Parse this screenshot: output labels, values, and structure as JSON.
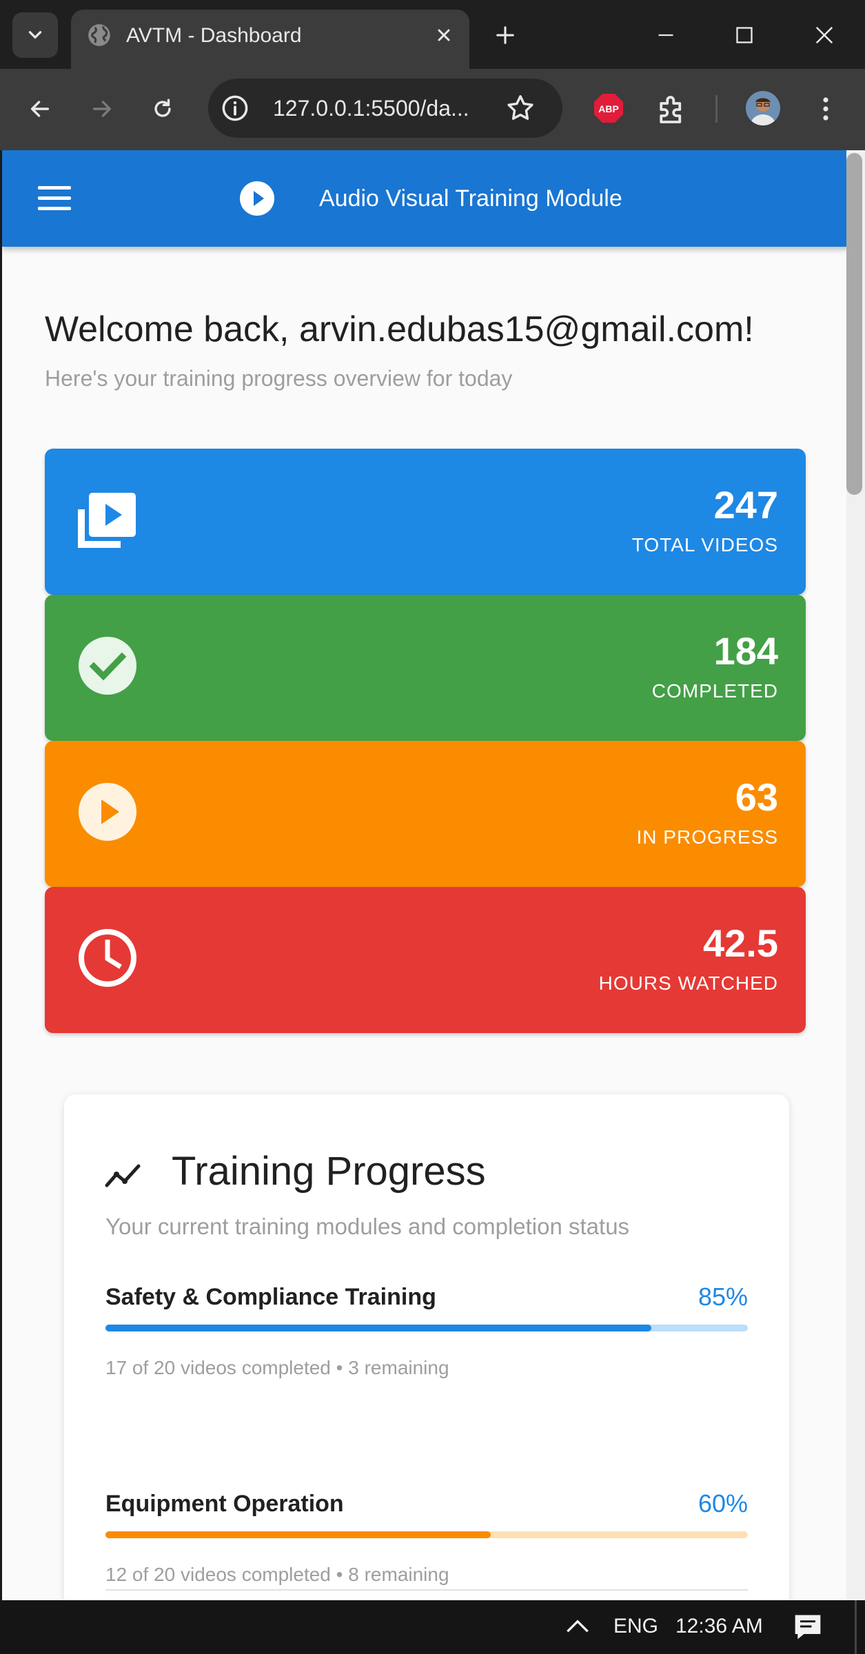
{
  "browser": {
    "tab_title": "AVTM - Dashboard",
    "url": "127.0.0.1:5500/da...",
    "extension_badge": "ABP"
  },
  "app": {
    "title": "Audio Visual Training Module",
    "primary_color": "#1976d2"
  },
  "welcome": {
    "heading": "Welcome back, arvin.edubas15@gmail.com!",
    "subtitle": "Here's your training progress overview for today"
  },
  "stats": [
    {
      "value": "247",
      "label": "TOTAL VIDEOS",
      "icon": "video-library-icon",
      "color": "#1e88e5"
    },
    {
      "value": "184",
      "label": "COMPLETED",
      "icon": "check-circle-icon",
      "color": "#43a047"
    },
    {
      "value": "63",
      "label": "IN PROGRESS",
      "icon": "play-circle-icon",
      "color": "#fb8c00"
    },
    {
      "value": "42.5",
      "label": "HOURS WATCHED",
      "icon": "clock-icon",
      "color": "#e53935"
    }
  ],
  "training_progress": {
    "title": "Training Progress",
    "subtitle": "Your current training modules and completion status",
    "modules": [
      {
        "name": "Safety & Compliance Training",
        "percent_label": "85%",
        "progress": 0.85,
        "detail": "17 of 20 videos completed • 3 remaining",
        "color": "#1e88e5",
        "track_color": "#bbdefb"
      },
      {
        "name": "Equipment Operation",
        "percent_label": "60%",
        "progress": 0.6,
        "detail": "12 of 20 videos completed • 8 remaining",
        "color": "#fb8c00",
        "track_color": "#ffe0b2"
      }
    ]
  },
  "taskbar": {
    "language": "ENG",
    "time": "12:36 AM"
  }
}
